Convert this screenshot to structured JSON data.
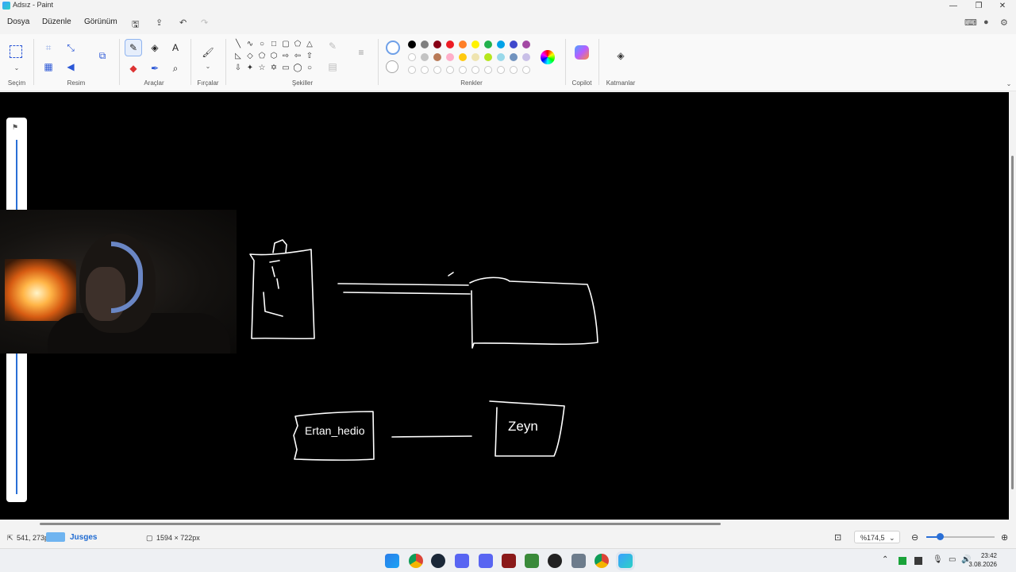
{
  "window": {
    "title": "Adsız - Paint"
  },
  "menu": {
    "file": "Dosya",
    "edit": "Düzenle",
    "view": "Görünüm"
  },
  "ribbon": {
    "groups": {
      "selection": "Seçim",
      "image": "Resim",
      "tools": "Araçlar",
      "brushes": "Fırçalar",
      "shapes": "Şekiller",
      "colors": "Renkler",
      "copilot": "Copilot",
      "layers": "Katmanlar"
    },
    "palette_row1": [
      "#000000",
      "#7f7f7f",
      "#880015",
      "#ed1c24",
      "#ff7f27",
      "#fff200",
      "#22b14c",
      "#00a2e8",
      "#3f48cc",
      "#a349a4"
    ],
    "palette_row2": [
      "#ffffff",
      "#c3c3c3",
      "#b97a57",
      "#ffaec9",
      "#ffc90e",
      "#efe4b0",
      "#b5e61d",
      "#99d9ea",
      "#7092be",
      "#c8bfe7"
    ]
  },
  "canvas": {
    "background": "#000000",
    "stroke_color": "#ffffff",
    "text_box_left": "Ertan_hedio",
    "text_box_right": "Zeyn"
  },
  "status": {
    "cursor_pos": "541, 273px",
    "overlay_label": "Jusges",
    "image_size": "1594 × 722px",
    "zoom": "%174,5"
  },
  "taskbar": {
    "time": "23:42",
    "date": "3.08.2026"
  }
}
